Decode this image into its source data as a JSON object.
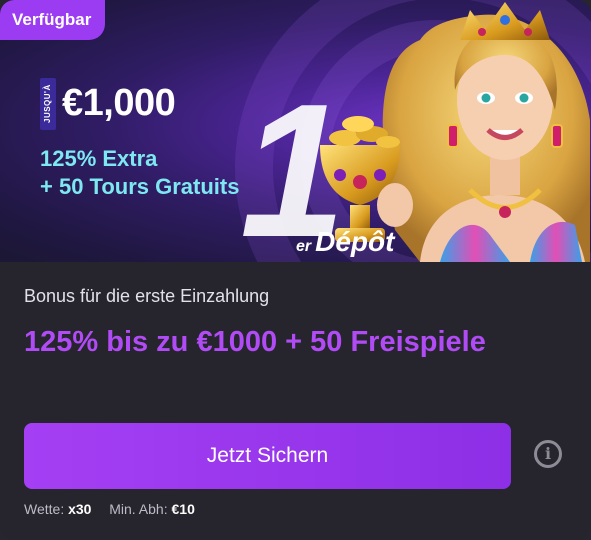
{
  "badge": "Verfügbar",
  "banner": {
    "upto": "JUSQU'À",
    "amount": "€1,000",
    "extra_line1": "125% Extra",
    "extra_line2": "+ 50 Tours Gratuits",
    "big_number": "1",
    "deposit_suffix": "er",
    "deposit_word": "Dépôt"
  },
  "subtitle": "Bonus für die erste Einzahlung",
  "offer": "125% bis zu €1000 + 50 Freispiele",
  "cta_label": "Jetzt Sichern",
  "info_icon": "i",
  "terms": {
    "wager_label": "Wette:",
    "wager_value": "x30",
    "min_label": "Min. Abh:",
    "min_value": "€10"
  },
  "colors": {
    "accent": "#9b3cf2",
    "offer_text": "#b14bf5",
    "cyan_text": "#7de8f0",
    "card_bg": "#26252e"
  }
}
